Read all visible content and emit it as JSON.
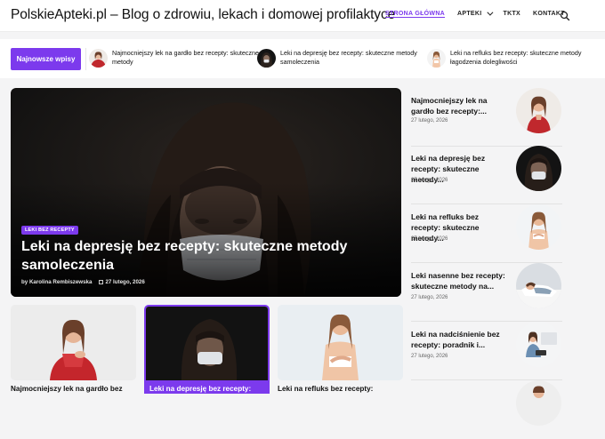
{
  "header": {
    "site_title": "PolskieApteki.pl – Blog o zdrowiu, lekach i domowej profilaktyce",
    "nav": [
      {
        "label": "STRONA GŁÓWNA",
        "active": true
      },
      {
        "label": "APTEKI",
        "has_dropdown": true
      },
      {
        "label": "TKTX"
      },
      {
        "label": "KONTAKT"
      }
    ],
    "search_icon": "search-icon"
  },
  "ticker": {
    "badge": "Najnowsze wpisy",
    "items": [
      {
        "title": "Najmocniejszy lek na gardło bez recepty: skuteczne metody"
      },
      {
        "title": "Leki na depresję bez recepty: skuteczne metody samoleczenia"
      },
      {
        "title": "Leki na refluks bez recepty: skuteczne metody łagodzenia dolegliwości"
      }
    ]
  },
  "hero": {
    "category": "LEKI BEZ RECEPTY",
    "title": "Leki na depresję bez recepty: skuteczne metody samoleczenia",
    "author": "by Karolina Rembiszewska",
    "date": "27 lutego, 2026"
  },
  "sidebar": {
    "items": [
      {
        "title": "Najmocniejszy lek na gardło bez recepty:...",
        "date": "27 lutego, 2026"
      },
      {
        "title": "Leki na depresję bez recepty: skuteczne metody...",
        "date": "27 lutego, 2026"
      },
      {
        "title": "Leki na refluks bez recepty: skuteczne metody...",
        "date": "27 lutego, 2026"
      },
      {
        "title": "Leki nasenne bez recepty: skuteczne metody na...",
        "date": "27 lutego, 2026"
      },
      {
        "title": "Leki na nadciśnienie bez recepty: poradnik i...",
        "date": "27 lutego, 2026"
      }
    ]
  },
  "cards": [
    {
      "title": "Najmocniejszy lek na gardło bez"
    },
    {
      "title": "Leki na depresję bez recepty:"
    },
    {
      "title": "Leki na refluks bez recepty:"
    }
  ],
  "colors": {
    "accent": "#7c3aed",
    "dark_photo": "#151515"
  }
}
